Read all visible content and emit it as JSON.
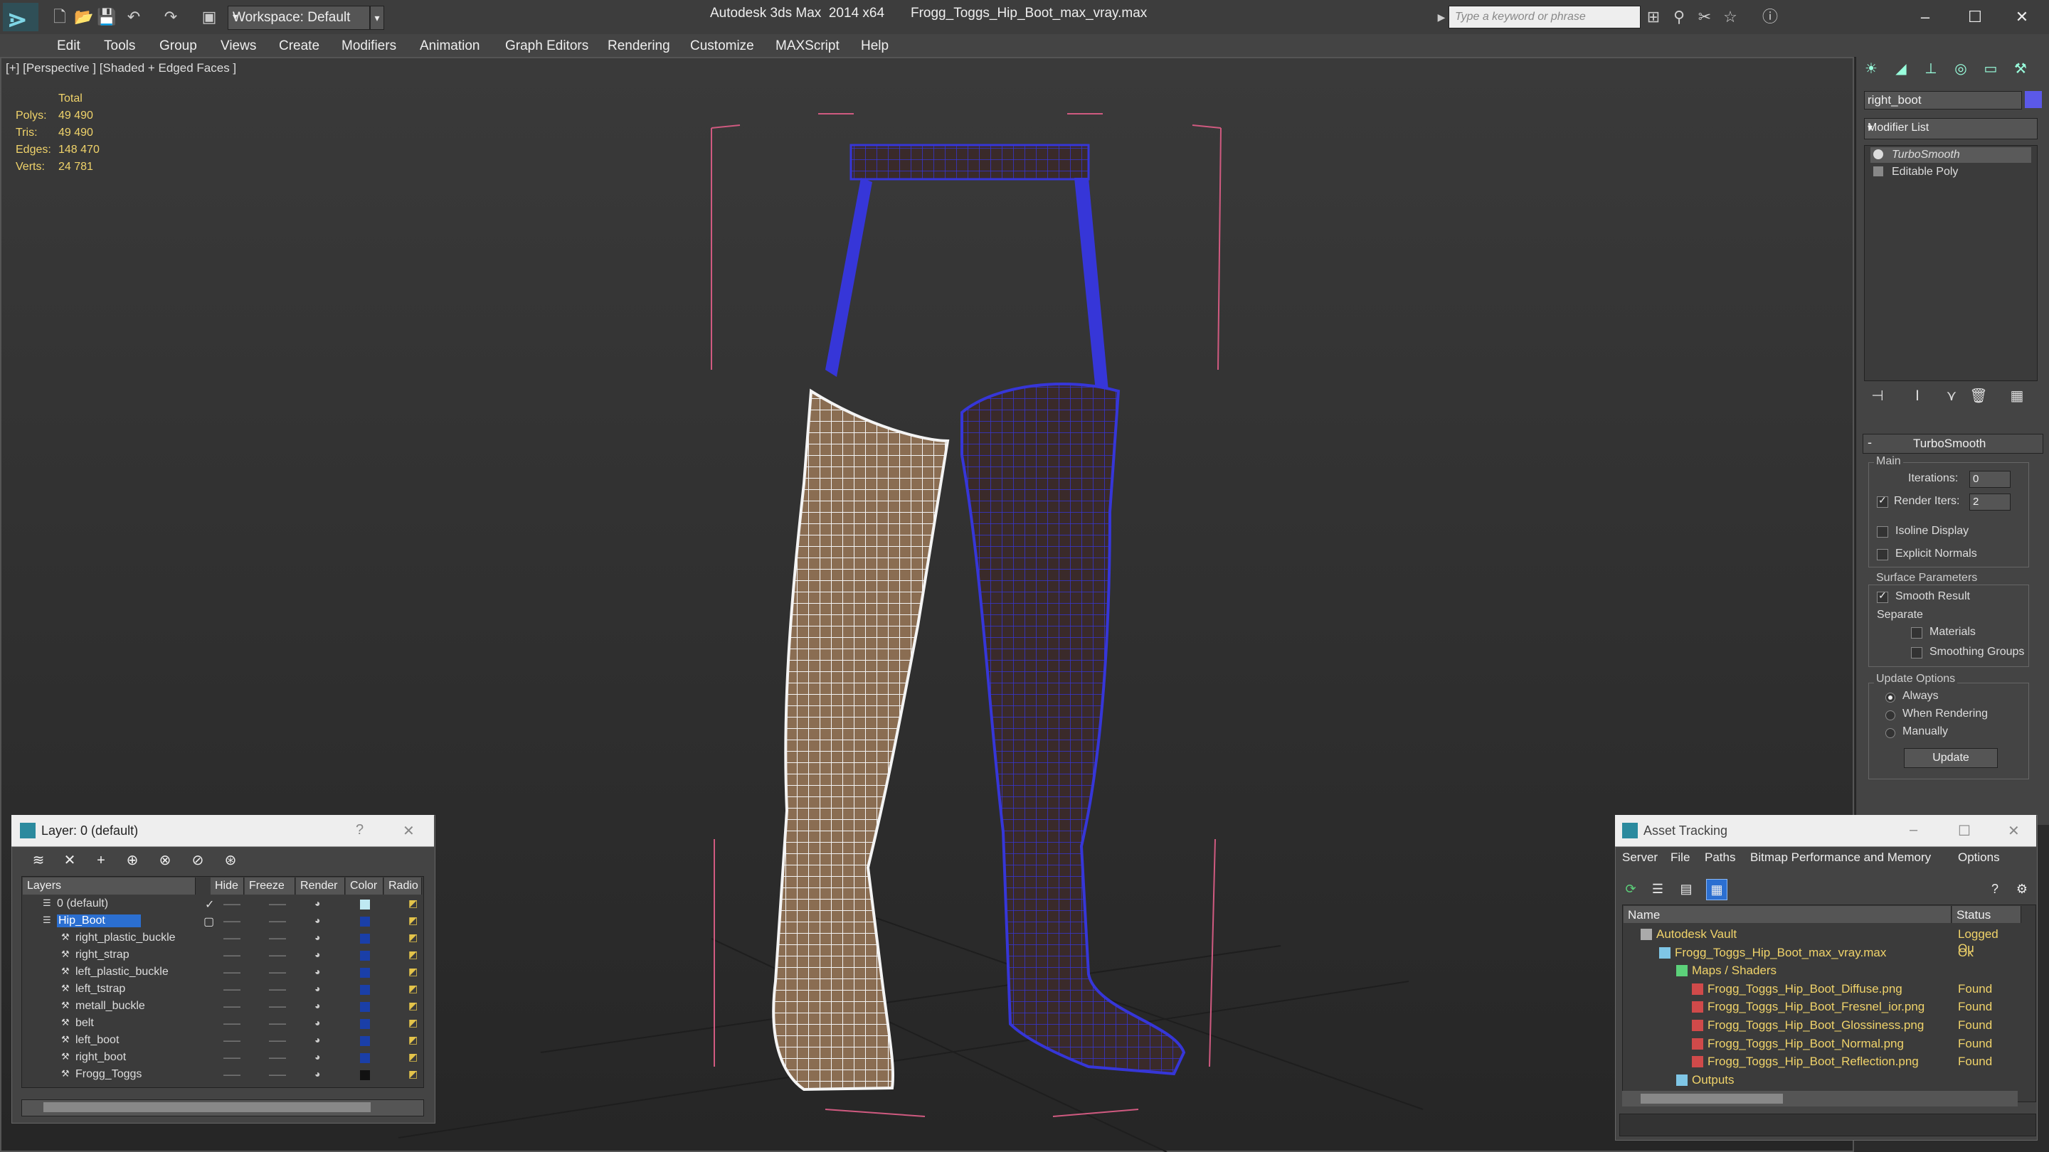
{
  "titlebar": {
    "workspace": "Workspace: Default",
    "app_title": "Autodesk 3ds Max  2014 x64       Frogg_Toggs_Hip_Boot_max_vray.max",
    "search_placeholder": "Type a keyword or phrase"
  },
  "menu": [
    "Edit",
    "Tools",
    "Group",
    "Views",
    "Create",
    "Modifiers",
    "Animation",
    "Graph Editors",
    "Rendering",
    "Customize",
    "MAXScript",
    "Help"
  ],
  "viewport": {
    "label": "[+] [Perspective ] [Shaded + Edged Faces ]",
    "stats": {
      "header": "Total",
      "polys_label": "Polys:",
      "polys": "49 490",
      "tris_label": "Tris:",
      "tris": "49 490",
      "edges_label": "Edges:",
      "edges": "148 470",
      "verts_label": "Verts:",
      "verts": "24 781"
    }
  },
  "command_panel": {
    "object_name": "right_boot",
    "object_color": "#5b59e8",
    "modifier_list": "Modifier List",
    "stack": [
      "TurboSmooth",
      "Editable Poly"
    ],
    "rollout": {
      "title": "TurboSmooth",
      "main_label": "Main",
      "iterations_label": "Iterations:",
      "iterations": "0",
      "render_iters_label": "Render Iters:",
      "render_iters": "2",
      "isoline_label": "Isoline Display",
      "explicit_label": "Explicit Normals",
      "surface_label": "Surface Parameters",
      "smooth_label": "Smooth Result",
      "separate_label": "Separate",
      "materials_label": "Materials",
      "smoothing_label": "Smoothing Groups",
      "update_options_label": "Update Options",
      "always_label": "Always",
      "when_rendering_label": "When Rendering",
      "manually_label": "Manually",
      "update_button": "Update"
    }
  },
  "layer_dialog": {
    "title": "Layer: 0 (default)",
    "help": "?",
    "columns": [
      "Layers",
      "Hide",
      "Freeze",
      "Render",
      "Color",
      "Radio"
    ],
    "rows": [
      {
        "name": "0 (default)",
        "color": "#bfe9f2"
      },
      {
        "name": "Hip_Boot",
        "color": "#1a3fa8"
      },
      {
        "name": "right_plastic_buckle",
        "color": "#1a3fa8"
      },
      {
        "name": "right_strap",
        "color": "#1a3fa8"
      },
      {
        "name": "left_plastic_buckle",
        "color": "#1a3fa8"
      },
      {
        "name": "left_tstrap",
        "color": "#1a3fa8"
      },
      {
        "name": "metall_buckle",
        "color": "#1a3fa8"
      },
      {
        "name": "belt",
        "color": "#1a3fa8"
      },
      {
        "name": "left_boot",
        "color": "#1a3fa8"
      },
      {
        "name": "right_boot",
        "color": "#1a3fa8"
      },
      {
        "name": "Frogg_Toggs",
        "color": "#111111"
      }
    ]
  },
  "asset_dialog": {
    "title": "Asset Tracking",
    "menu": [
      "Server",
      "File",
      "Paths",
      "Bitmap Performance and Memory",
      "Options"
    ],
    "columns": [
      "Name",
      "Status"
    ],
    "rows": [
      {
        "name": "Autodesk Vault",
        "status": "Logged Ou"
      },
      {
        "name": "Frogg_Toggs_Hip_Boot_max_vray.max",
        "status": "Ok"
      },
      {
        "name": "Maps / Shaders",
        "status": ""
      },
      {
        "name": "Frogg_Toggs_Hip_Boot_Diffuse.png",
        "status": "Found"
      },
      {
        "name": "Frogg_Toggs_Hip_Boot_Fresnel_ior.png",
        "status": "Found"
      },
      {
        "name": "Frogg_Toggs_Hip_Boot_Glossiness.png",
        "status": "Found"
      },
      {
        "name": "Frogg_Toggs_Hip_Boot_Normal.png",
        "status": "Found"
      },
      {
        "name": "Frogg_Toggs_Hip_Boot_Reflection.png",
        "status": "Found"
      },
      {
        "name": "Outputs",
        "status": ""
      }
    ]
  }
}
